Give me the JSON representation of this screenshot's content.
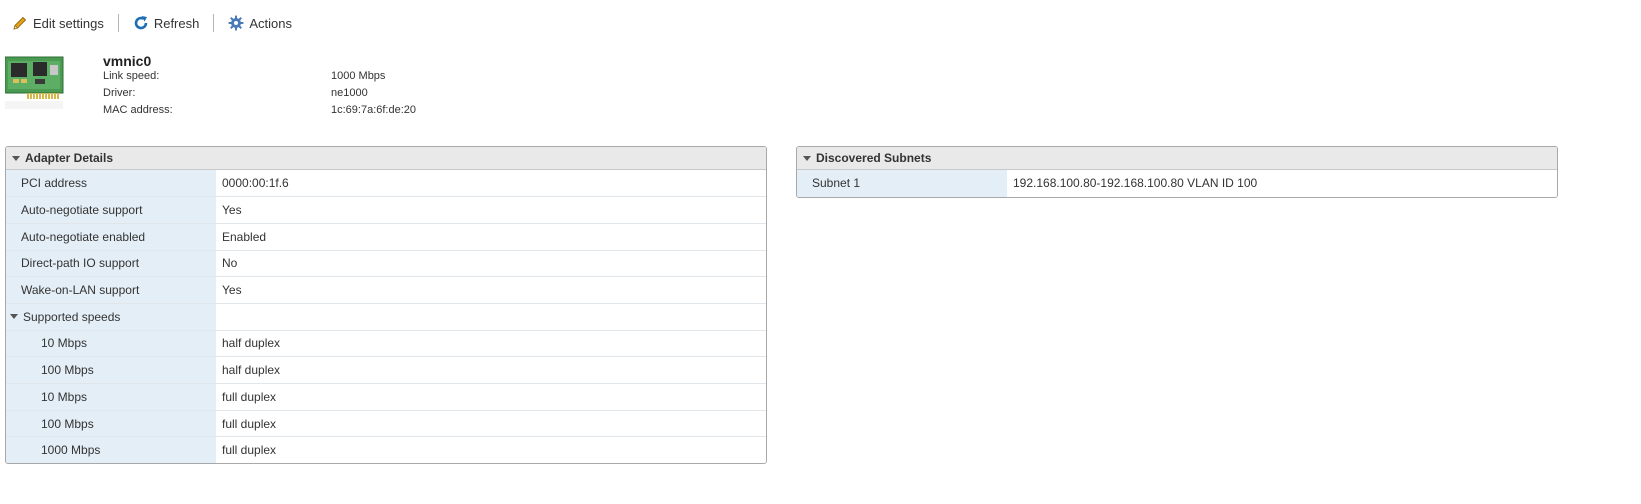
{
  "toolbar": {
    "edit_label": "Edit settings",
    "refresh_label": "Refresh",
    "actions_label": "Actions"
  },
  "colors": {
    "accent_blue": "#1f6fb5",
    "pencil_orange": "#e3a21a",
    "gear_blue": "#4a7ab8",
    "key_cell_bg": "#e4eef6",
    "panel_header_bg": "#e9e9e9"
  },
  "icons": {
    "edit": "pencil-icon",
    "refresh": "refresh-icon",
    "actions": "gear-icon",
    "nic": "network-card-icon"
  },
  "adapter": {
    "name": "vmnic0",
    "link_speed_label": "Link speed:",
    "link_speed": "1000 Mbps",
    "driver_label": "Driver:",
    "driver": "ne1000",
    "mac_label": "MAC address:",
    "mac": "1c:69:7a:6f:de:20"
  },
  "adapter_details": {
    "title": "Adapter Details",
    "rows": [
      {
        "key": "PCI address",
        "value": "0000:00:1f.6"
      },
      {
        "key": "Auto-negotiate support",
        "value": "Yes"
      },
      {
        "key": "Auto-negotiate enabled",
        "value": "Enabled"
      },
      {
        "key": "Direct-path IO support",
        "value": "No"
      },
      {
        "key": "Wake-on-LAN support",
        "value": "Yes"
      }
    ],
    "speeds_label": "Supported speeds",
    "speeds": [
      {
        "speed": "10 Mbps",
        "duplex": "half duplex"
      },
      {
        "speed": "100 Mbps",
        "duplex": "half duplex"
      },
      {
        "speed": "10 Mbps",
        "duplex": "full duplex"
      },
      {
        "speed": "100 Mbps",
        "duplex": "full duplex"
      },
      {
        "speed": "1000 Mbps",
        "duplex": "full duplex"
      }
    ]
  },
  "discovered_subnets": {
    "title": "Discovered Subnets",
    "rows": [
      {
        "key": "Subnet 1",
        "value": "192.168.100.80-192.168.100.80 VLAN ID 100"
      }
    ]
  }
}
